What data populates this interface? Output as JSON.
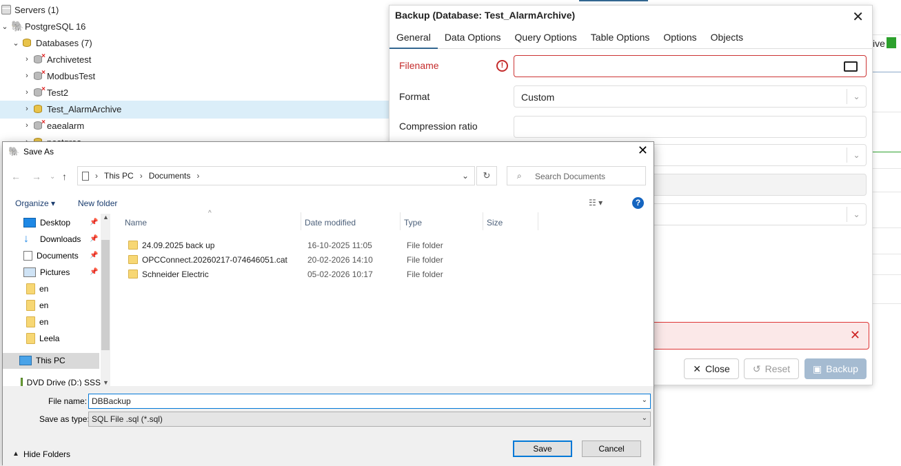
{
  "tree": {
    "servers": "Servers (1)",
    "server": "PostgreSQL 16",
    "databases": "Databases (7)",
    "items": [
      "Archivetest",
      "ModbusTest",
      "Test2",
      "Test_AlarmArchive",
      "eaealarm",
      "postgres"
    ]
  },
  "right_partial": "ive",
  "backup": {
    "title": "Backup (Database: Test_AlarmArchive)",
    "tabs": [
      "General",
      "Data Options",
      "Query Options",
      "Table Options",
      "Options",
      "Objects"
    ],
    "filename_label": "Filename",
    "filename_value": "",
    "format_label": "Format",
    "format_value": "Custom",
    "compression_label": "Compression ratio",
    "close_label": "Close",
    "reset_label": "Reset",
    "backup_label": "Backup"
  },
  "saveas": {
    "title": "Save As",
    "breadcrumb": [
      "This PC",
      "Documents"
    ],
    "search_placeholder": "Search Documents",
    "organize": "Organize",
    "new_folder": "New folder",
    "nav": {
      "desktop": "Desktop",
      "downloads": "Downloads",
      "documents": "Documents",
      "pictures": "Pictures",
      "en1": "en",
      "en2": "en",
      "en3": "en",
      "leela": "Leela",
      "this_pc": "This PC",
      "dvd": "DVD Drive (D:) SSS"
    },
    "columns": [
      "Name",
      "Date modified",
      "Type",
      "Size"
    ],
    "files": [
      {
        "name": "24.09.2025 back up",
        "date": "16-10-2025 11:05",
        "type": "File folder"
      },
      {
        "name": "OPCConnect.20260217-074646051.cat",
        "date": "20-02-2026 14:10",
        "type": "File folder"
      },
      {
        "name": "Schneider Electric",
        "date": "05-02-2026 10:17",
        "type": "File folder"
      }
    ],
    "file_name_label": "File name:",
    "file_name_value": "DBBackup",
    "save_type_label": "Save as type:",
    "save_type_value": "SQL File .sql (*.sql)",
    "hide_folders": "Hide Folders",
    "save": "Save",
    "cancel": "Cancel"
  }
}
